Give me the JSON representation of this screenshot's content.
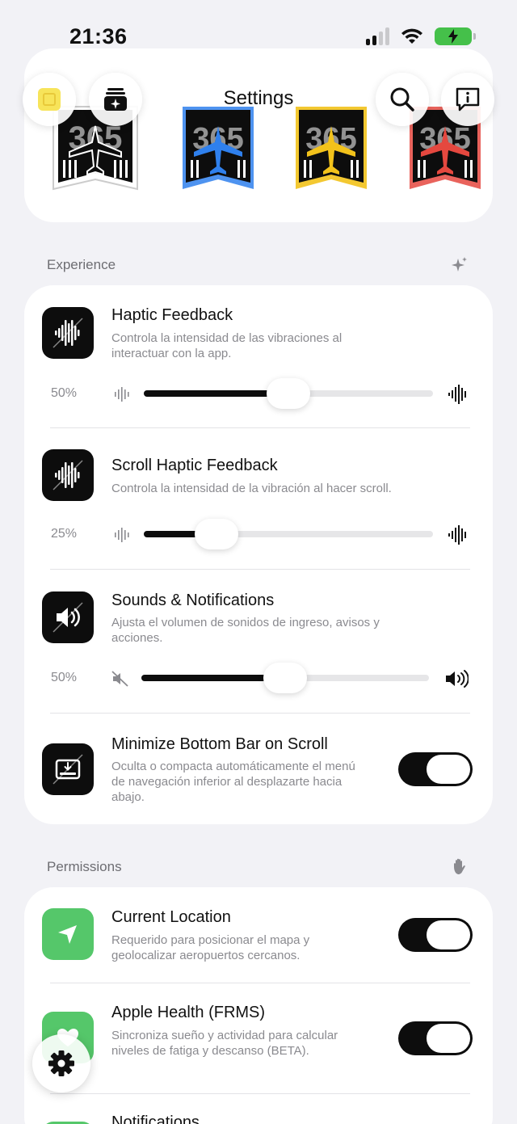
{
  "status": {
    "time": "21:36"
  },
  "header": {
    "title": "Settings"
  },
  "icons": {
    "variant_text": "365",
    "variants": [
      {
        "name": "black",
        "color": "#111111"
      },
      {
        "name": "blue",
        "color": "#2f80ed"
      },
      {
        "name": "yellow",
        "color": "#f2c21b"
      },
      {
        "name": "red",
        "color": "#e5483f"
      }
    ]
  },
  "sections": {
    "experience": {
      "label": "Experience",
      "haptic": {
        "title": "Haptic Feedback",
        "desc": "Controla la intensidad de las vibraciones al interactuar con la app.",
        "value_label": "50%",
        "value": 0.5
      },
      "scroll_haptic": {
        "title": "Scroll Haptic Feedback",
        "desc": "Controla la intensidad de la vibración al hacer scroll.",
        "value_label": "25%",
        "value": 0.25
      },
      "sounds": {
        "title": "Sounds & Notifications",
        "desc": "Ajusta el volumen de sonidos de ingreso, avisos y acciones.",
        "value_label": "50%",
        "value": 0.5
      },
      "minimize_bar": {
        "title": "Minimize Bottom Bar on Scroll",
        "desc": "Oculta o compacta automáticamente el menú de navegación inferior al desplazarte hacia abajo.",
        "enabled": true
      }
    },
    "permissions": {
      "label": "Permissions",
      "location": {
        "title": "Current Location",
        "desc": "Requerido para posicionar el mapa y geolocalizar aeropuertos cercanos.",
        "enabled": true
      },
      "health": {
        "title": "Apple Health (FRMS)",
        "desc": "Sincroniza sueño y actividad para calcular niveles de fatiga y descanso (BETA).",
        "enabled": true
      },
      "notifications": {
        "title": "Notifications"
      }
    }
  },
  "colors": {
    "accent": "#0d0d0d",
    "battery": "#45c04a",
    "green_icon": "#55c76a",
    "background": "#f2f2f6"
  }
}
